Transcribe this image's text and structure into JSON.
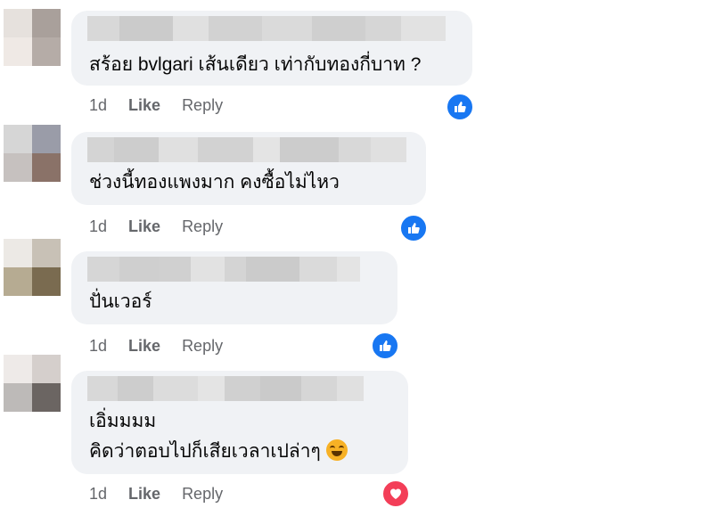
{
  "comments": [
    {
      "author_name": "",
      "text_lines": [
        "สร้อย bvlgari เส้นเดียว เท่ากับทองกี่บาท ?"
      ],
      "time": "1d",
      "like_label": "Like",
      "reply_label": "Reply",
      "reaction": "like-icon",
      "avatar_colors": [
        "#d9d0ca",
        "#a9a09b",
        "#ece5e1",
        "#b5aca7"
      ]
    },
    {
      "author_name": "",
      "text_lines": [
        "ช่วงนี้ทองแพงมาก คงซื้อไม่ไหว"
      ],
      "time": "1d",
      "like_label": "Like",
      "reply_label": "Reply",
      "reaction": "like-icon",
      "avatar_colors": [
        "#c9c9c9",
        "#9a9ca8",
        "#b9b4b2",
        "#8a7268"
      ]
    },
    {
      "author_name": "",
      "text_lines": [
        "ปั่นเวอร์"
      ],
      "time": "1d",
      "like_label": "Like",
      "reply_label": "Reply",
      "reaction": "like-icon",
      "avatar_colors": [
        "#ddd9d4",
        "#c8c1b6",
        "#b6ab92",
        "#7a6b50"
      ]
    },
    {
      "author_name": "",
      "text_lines": [
        "เอิ่มมมม",
        "คิดว่าตอบไปก็เสียเวลาเปล่าๆ"
      ],
      "time": "1d",
      "like_label": "Like",
      "reply_label": "Reply",
      "reaction": "heart-icon",
      "avatar_colors": [
        "#e2dcda",
        "#d5cfcc",
        "#bdbab8",
        "#6b6562"
      ]
    }
  ],
  "colors": {
    "bubble_bg": "#f0f2f5",
    "like_blue": "#1877f2",
    "love_red": "#f33e58",
    "meta_gray": "#65676b"
  }
}
